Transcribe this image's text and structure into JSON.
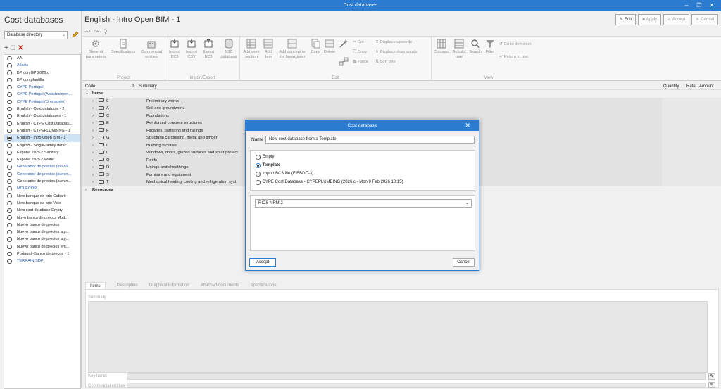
{
  "window": {
    "title": "Cost databases"
  },
  "sidebar": {
    "title": "Cost databases",
    "selector": "Database directory",
    "items": [
      {
        "label": "AA",
        "blue": false
      },
      {
        "label": "Aliaxis",
        "blue": true
      },
      {
        "label": "BP con GP 2026.c",
        "blue": false
      },
      {
        "label": "BP con plantilla",
        "blue": false
      },
      {
        "label": "CYPE Portugal",
        "blue": true
      },
      {
        "label": "CYPE Portugal (Abastecimen...",
        "blue": true
      },
      {
        "label": "CYPE Portugal (Drenagem)",
        "blue": true
      },
      {
        "label": "English - Cost database - 2",
        "blue": false
      },
      {
        "label": "English - Cost databases - 1",
        "blue": false
      },
      {
        "label": "English - CYPE Cost Databas...",
        "blue": false
      },
      {
        "label": "English - CYPEPLUMBING - 1",
        "blue": false
      },
      {
        "label": "English - Intro Open BIM - 1",
        "blue": false,
        "selected": true
      },
      {
        "label": "English - Single-family detac...",
        "blue": false
      },
      {
        "label": "España 2025.c Sanitary",
        "blue": false
      },
      {
        "label": "España 2025.c Water",
        "blue": false
      },
      {
        "label": "Generador de precios (evacu...",
        "blue": true
      },
      {
        "label": "Generador de precios (sumin...",
        "blue": true
      },
      {
        "label": "Generador de precios (sumin...",
        "blue": false
      },
      {
        "label": "MOLECOR",
        "blue": true
      },
      {
        "label": "New banque de prix Gabarit",
        "blue": false
      },
      {
        "label": "New banque de prix Vide",
        "blue": false
      },
      {
        "label": "New cost database Empty",
        "blue": false
      },
      {
        "label": "Novo banco de preços Mod...",
        "blue": false
      },
      {
        "label": "Nuevo banco de precios",
        "blue": false
      },
      {
        "label": "Nuevo banco de precios a p...",
        "blue": false
      },
      {
        "label": "Nuevo banco de precios a p...",
        "blue": false
      },
      {
        "label": "Nuevo banco de precios em...",
        "blue": false
      },
      {
        "label": "Portugal -Banco de preços - 1",
        "blue": false
      },
      {
        "label": "TERRAIN SDP",
        "blue": true
      }
    ]
  },
  "main": {
    "title": "English - Intro Open BIM - 1",
    "buttons": {
      "edit": "Edit",
      "apply": "Apply",
      "accept": "Accept",
      "cancel": "Cancel"
    }
  },
  "ribbon": {
    "groups": {
      "project": "Project",
      "import_export": "Import/Export",
      "edit": "Edit",
      "view": "View"
    },
    "general": [
      "General",
      "parameters"
    ],
    "specifications": "Specifications",
    "commercial": [
      "Commercial",
      "entities"
    ],
    "import_bc3": [
      "Import",
      "BC3"
    ],
    "import_csv": [
      "Import",
      "CSV"
    ],
    "export_bc3": [
      "Export",
      "BC3"
    ],
    "n3c": [
      "N3C",
      "database"
    ],
    "add_work": [
      "Add work",
      "section"
    ],
    "add_item": [
      "Add",
      "item"
    ],
    "add_concept": [
      "Add concept to",
      "the breakdown"
    ],
    "copy_big": "Copy",
    "delete": "Delete",
    "cut": "Cut",
    "copy_small": "Copy",
    "paste": "Paste",
    "displace_up": "Displace upwards",
    "displace_down": "Displace downwards",
    "sort_tree": "Sort tree",
    "columns": "Columns",
    "rebuild": [
      "Rebuild",
      "tree"
    ],
    "search": "Search",
    "filter": "Filter",
    "go_def": "Go to definition",
    "return_use": "Return to use"
  },
  "grid": {
    "headers": {
      "code": "Code",
      "ut": "Ut",
      "summary": "Summary",
      "quantity": "Quantity",
      "rate": "Rate",
      "amount": "Amount"
    },
    "items_label": "Items",
    "resources_label": "Resources",
    "rows": [
      {
        "code": "0",
        "summary": "Preliminary works"
      },
      {
        "code": "A",
        "summary": "Soil and groundwork"
      },
      {
        "code": "C",
        "summary": "Foundations"
      },
      {
        "code": "E",
        "summary": "Reinforced concrete structures"
      },
      {
        "code": "F",
        "summary": "Façades, partitions and railings"
      },
      {
        "code": "G",
        "summary": "Structural carcassing, metal and timber"
      },
      {
        "code": "I",
        "summary": "Building facilities"
      },
      {
        "code": "L",
        "summary": "Windows, doors, glazed surfaces and solar protect"
      },
      {
        "code": "Q",
        "summary": "Roofs"
      },
      {
        "code": "R",
        "summary": "Linings and sheathings"
      },
      {
        "code": "S",
        "summary": "Furniture and equipment"
      },
      {
        "code": "T",
        "summary": "Mechanical heating, cooling and refrigeration syst"
      }
    ]
  },
  "tabs": [
    "Items",
    "Description",
    "Graphical information",
    "Attached documents",
    "Specifications"
  ],
  "panel": {
    "summary": "Summary",
    "key_terms": "Key terms",
    "commercial_entities": "Commercial entities"
  },
  "dialog": {
    "title": "Cost database",
    "name_label": "Name",
    "name_value": "New cost database from a Template",
    "options": [
      "Empty",
      "Template",
      "Import BC3 file (FIEBDC-3)",
      "CYPE Cost Database - CYPEPLUMBING (2026.c - Mon  9 Feb 2026  10:15)"
    ],
    "selected_option": 1,
    "template": "RICS NRM 2",
    "accept": "Accept",
    "cancel": "Cancel"
  }
}
